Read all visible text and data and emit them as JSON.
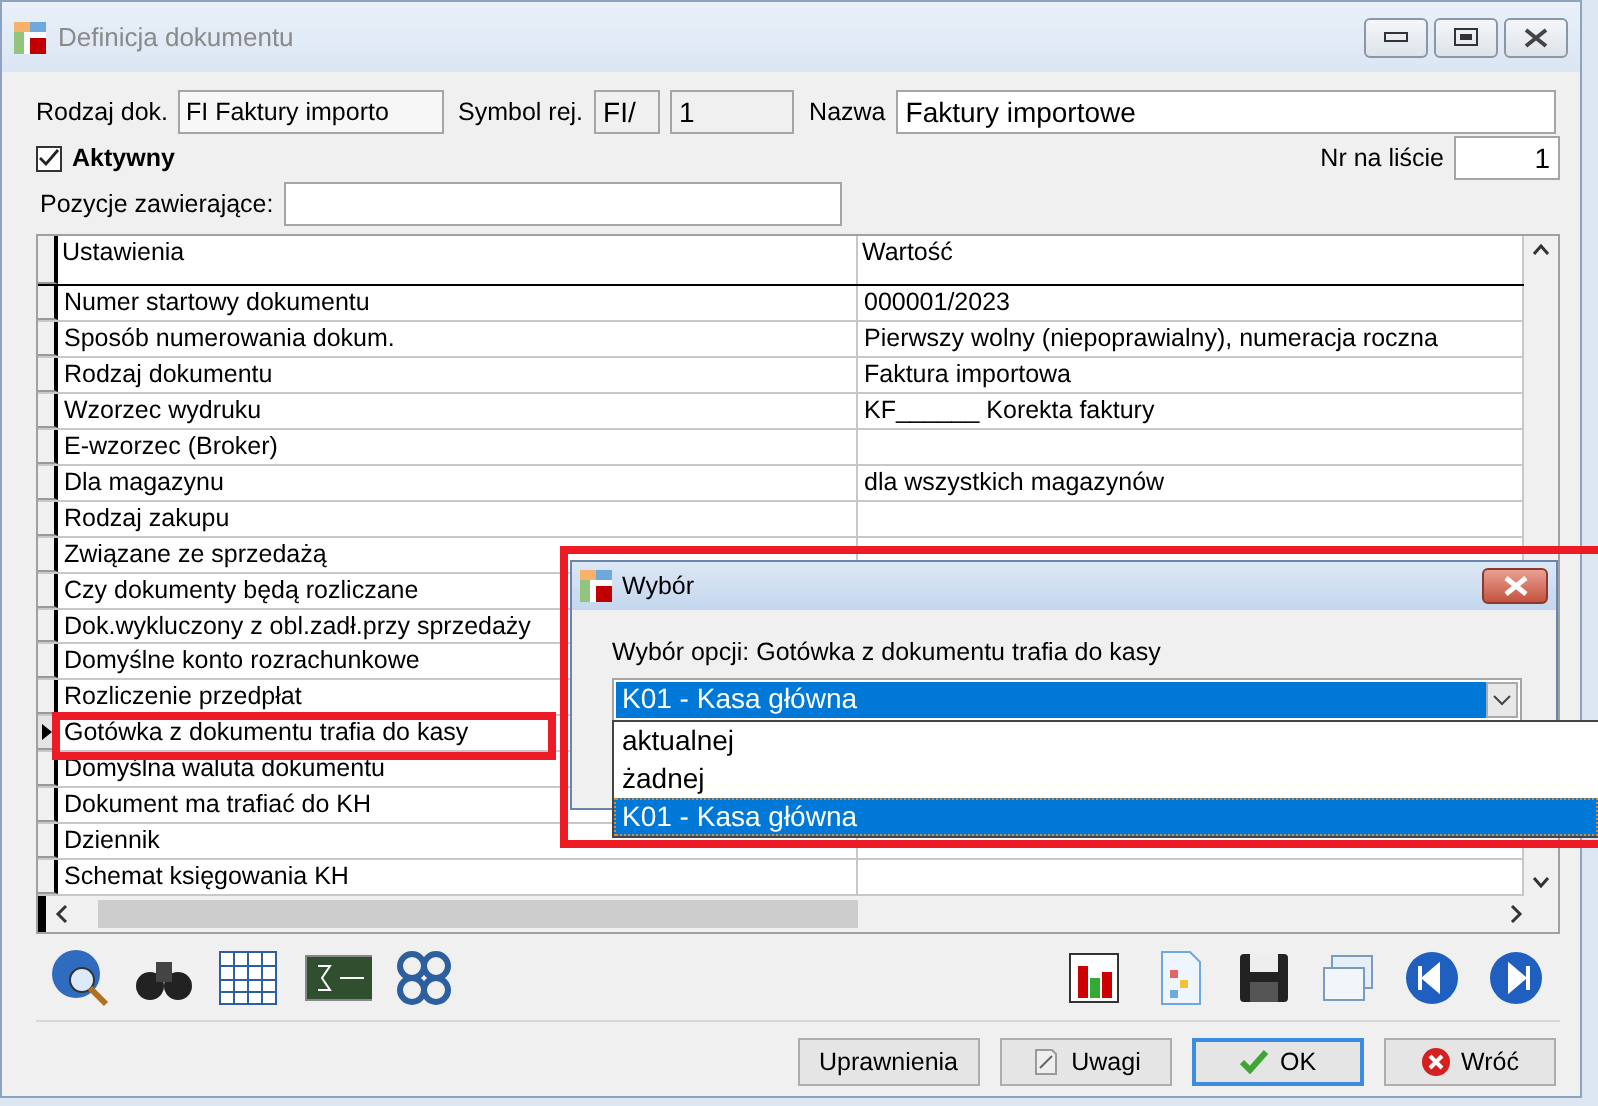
{
  "window": {
    "title": "Definicja dokumentu"
  },
  "form": {
    "doc_type_label": "Rodzaj dok.",
    "doc_type_value": "FI Faktury importo",
    "symbol_label": "Symbol rej.",
    "symbol_prefix": "FI/",
    "symbol_number": "1",
    "name_label": "Nazwa",
    "name_value": "Faktury importowe",
    "active_label": "Aktywny",
    "active_checked": true,
    "list_no_label": "Nr na liście",
    "list_no_value": "1",
    "positions_label": "Pozycje zawierające:"
  },
  "table": {
    "columns": [
      "Ustawienia",
      "Wartość"
    ],
    "rows": [
      {
        "setting": "Numer startowy dokumentu",
        "value": "000001/2023",
        "selected": false
      },
      {
        "setting": "Sposób numerowania dokum.",
        "value": "Pierwszy wolny  (niepoprawialny), numeracja roczna",
        "selected": false
      },
      {
        "setting": "Rodzaj dokumentu",
        "value": "Faktura importowa",
        "selected": false
      },
      {
        "setting": "Wzorzec wydruku",
        "value": "KF______ Korekta faktury",
        "selected": false
      },
      {
        "setting": "E-wzorzec (Broker)",
        "selected": false
      },
      {
        "setting": "Dla magazynu",
        "value": "dla wszystkich magazynów",
        "selected": false
      },
      {
        "setting": "Rodzaj zakupu",
        "selected": false
      },
      {
        "setting": "Związane ze sprzedażą",
        "selected": false
      },
      {
        "setting": "Czy dokumenty będą rozliczane",
        "selected": false
      },
      {
        "setting": "Dok.wykluczony z obl.zadł.przy sprzedaży",
        "selected": false
      },
      {
        "setting": "Domyślne konto rozrachunkowe",
        "selected": false
      },
      {
        "setting": "Rozliczenie przedpłat",
        "selected": false
      },
      {
        "setting": "Gotówka z dokumentu trafia do kasy",
        "selected": true
      },
      {
        "setting": "Domyślna waluta dokumentu",
        "selected": false
      },
      {
        "setting": "Dokument ma trafiać do KH",
        "selected": false
      },
      {
        "setting": "Dziennik",
        "selected": false
      },
      {
        "setting": "Schemat księgowania KH",
        "selected": false
      }
    ]
  },
  "buttons": [
    {
      "label": "Uprawnienia",
      "kind": "plain",
      "focused": false
    },
    {
      "label": "Uwagi",
      "kind": "notes",
      "focused": false
    },
    {
      "label": "OK",
      "kind": "ok",
      "focused": true
    },
    {
      "label": "Wróć",
      "kind": "cancel",
      "focused": false
    }
  ],
  "dialog": {
    "title": "Wybór",
    "prompt": "Wybór opcji:  Gotówka z dokumentu trafia do kasy",
    "value": "K01 - Kasa główna",
    "options": [
      {
        "label": "aktualnej",
        "selected": false
      },
      {
        "label": "żadnej",
        "selected": false
      },
      {
        "label": "K01 - Kasa główna",
        "selected": true
      }
    ]
  }
}
